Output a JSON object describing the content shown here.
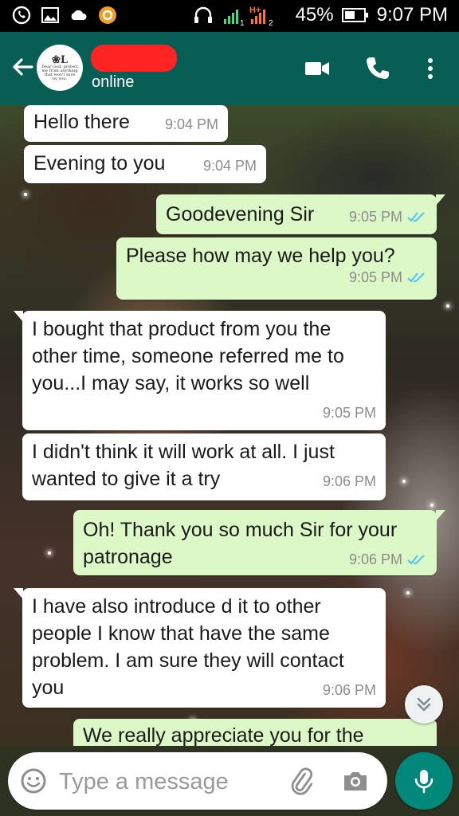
{
  "status_bar": {
    "battery": "45%",
    "time": "9:07 PM",
    "network_badge": "H+",
    "sim1": "1",
    "sim2": "2",
    "icons": [
      "whatsapp-icon",
      "gallery-icon",
      "weather-icon",
      "app-icon",
      "headset-icon",
      "signal-icon",
      "battery-icon"
    ]
  },
  "header": {
    "contact_name": "",
    "status": "online",
    "avatar_logo": "❀L",
    "avatar_text": "Dear God, protect me from anything that won't save by you.",
    "icons": [
      "back-arrow-icon",
      "video-call-icon",
      "phone-icon",
      "more-options-icon"
    ]
  },
  "messages": [
    {
      "direction": "in",
      "text": "Hello there",
      "time": "9:04 PM"
    },
    {
      "direction": "in",
      "text": "Evening to you",
      "time": "9:04 PM"
    },
    {
      "direction": "out",
      "text": "Goodevening Sir",
      "time": "9:05 PM",
      "read": true
    },
    {
      "direction": "out",
      "text": "Please how may we help you?",
      "time": "9:05 PM",
      "read": true
    },
    {
      "direction": "in",
      "text": "I bought that product from you the other time, someone referred me to you...I may say, it works so well",
      "time": "9:05 PM"
    },
    {
      "direction": "in",
      "text": "I didn't think it will work at all. I just wanted to give it a try",
      "time": "9:06 PM"
    },
    {
      "direction": "out",
      "text": "Oh! Thank you so much Sir for your patronage",
      "time": "9:06 PM",
      "read": true
    },
    {
      "direction": "in",
      "text": "I have also introduce d it to other people I know that have the same problem. I am sure they will contact you",
      "time": "9:06 PM"
    },
    {
      "direction": "out",
      "text": "We really appreciate you for the",
      "time": "",
      "read": false
    }
  ],
  "input_bar": {
    "placeholder": "Type a message",
    "icons": [
      "emoji-icon",
      "attach-icon",
      "camera-icon",
      "mic-icon"
    ]
  },
  "colors": {
    "header": "#075e54",
    "outgoing_bubble": "#dcf8c6",
    "incoming_bubble": "#ffffff",
    "read_ticks": "#4fc3f7",
    "mic_button": "#00897b",
    "contact_name_redaction": "#ff2424"
  }
}
